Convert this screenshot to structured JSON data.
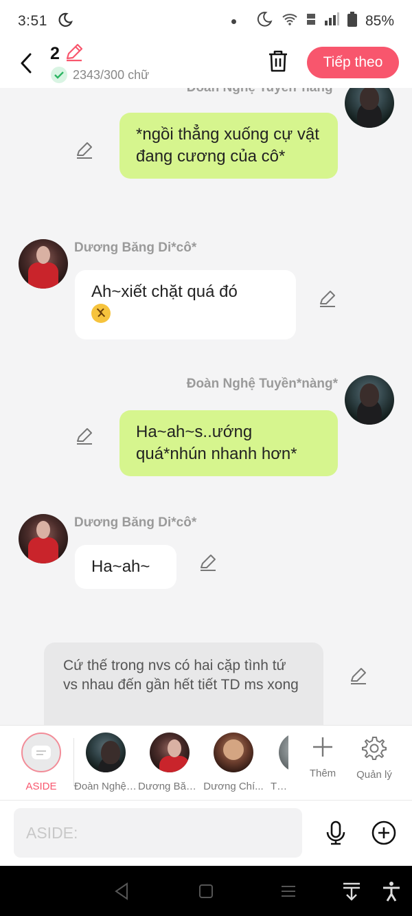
{
  "status_bar": {
    "time": "3:51",
    "battery": "85%"
  },
  "header": {
    "count": "2",
    "word_count": "2343/300 chữ",
    "next_label": "Tiếp theo"
  },
  "messages": [
    {
      "sender": "Đoàn Nghệ Tuyền*nàng*",
      "side": "right",
      "text": "*ngồi thẳng xuống cự vật đang cương của cô*"
    },
    {
      "sender": "Dương Băng Di*cô*",
      "side": "left",
      "text": "Ah~xiết chặt quá đó"
    },
    {
      "sender": "Đoàn Nghệ Tuyền*nàng*",
      "side": "right",
      "text": "Ha~ah~s..ướng quá*nhún nhanh hơn*"
    },
    {
      "sender": "Dương Băng Di*cô*",
      "side": "left",
      "text": "Ha~ah~"
    },
    {
      "sender": "",
      "side": "aside",
      "text": "Cứ thế trong nvs có hai cặp tình tứ vs nhau đến gần hết tiết TD ms xong"
    }
  ],
  "characters": [
    {
      "label": "ASIDE",
      "active": true
    },
    {
      "label": "Đoàn Nghệ Tuyền*nàng*"
    },
    {
      "label": "Dương Băng Di*cô*"
    },
    {
      "label": "Dương Chí..."
    },
    {
      "label": "Tả T"
    }
  ],
  "character_actions": {
    "add_label": "Thêm",
    "manage_label": "Quản lý"
  },
  "input": {
    "placeholder": "ASIDE:"
  },
  "colors": {
    "accent": "#f8566d",
    "my_bubble": "#d6f58e",
    "other_bubble": "#ffffff",
    "aside_bubble": "#e8e8e9"
  }
}
